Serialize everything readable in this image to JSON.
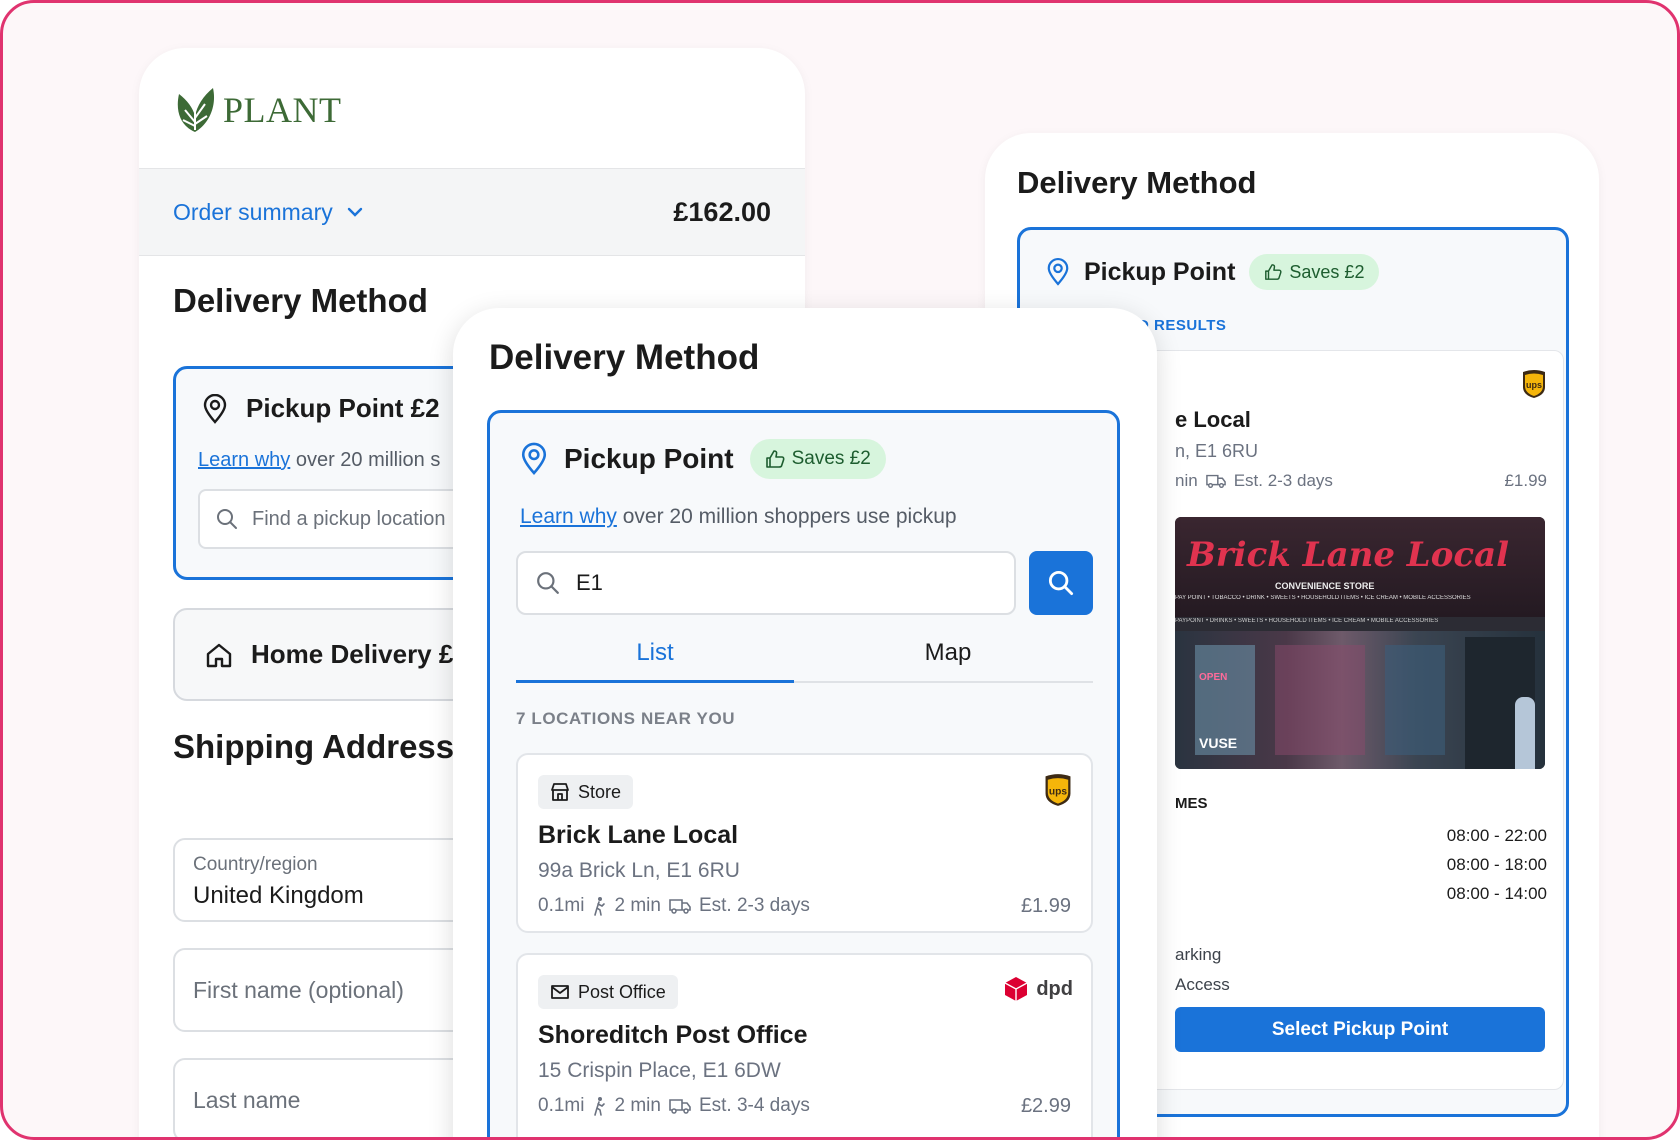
{
  "brand": {
    "name": "PLANT",
    "color": "#3d6a36"
  },
  "colors": {
    "accent": "#1a73d9",
    "frame": "#e0336f",
    "save_badge_bg": "#d7f5dd",
    "save_badge_text": "#1d5d2f"
  },
  "left_panel": {
    "order_summary_label": "Order summary",
    "order_total": "£162.00",
    "delivery_title": "Delivery Method",
    "pickup_label": "Pickup Point £2",
    "learn_link": "Learn why",
    "learn_rest": "over 20 million s",
    "search_placeholder": "Find a pickup location",
    "home_label": "Home Delivery £",
    "shipping_title": "Shipping Address",
    "country_label": "Country/region",
    "country_value": "United Kingdom",
    "first_name_placeholder": "First name (optional)",
    "last_name_placeholder": "Last name"
  },
  "center_panel": {
    "title": "Delivery Method",
    "pickup_label": "Pickup Point",
    "saves_badge": "Saves £2",
    "learn_link": "Learn why",
    "learn_rest": "over 20 million shoppers use pickup",
    "search_value": "E1",
    "tabs": [
      {
        "label": "List",
        "active": true
      },
      {
        "label": "Map",
        "active": false
      }
    ],
    "count_label": "7 LOCATIONS NEAR YOU",
    "locations": [
      {
        "type": "Store",
        "type_icon": "store-icon",
        "carrier": "ups",
        "name": "Brick Lane Local",
        "address": "99a Brick Ln, E1 6RU",
        "distance": "0.1mi",
        "walk": "2 min",
        "est": "Est. 2-3 days",
        "price": "£1.99"
      },
      {
        "type": "Post Office",
        "type_icon": "envelope-icon",
        "carrier": "dpd",
        "name": "Shoreditch Post Office",
        "address": "15 Crispin Place, E1 6DW",
        "distance": "0.1mi",
        "walk": "2 min",
        "est": "Est. 3-4 days",
        "price": "£2.99"
      }
    ]
  },
  "right_panel": {
    "title": "Delivery Method",
    "pickup_label": "Pickup Point",
    "saves_badge": "Saves £2",
    "results_partial": "D RESULTS",
    "carrier": "ups",
    "name_partial": "e Local",
    "address_partial": "n, E1 6RU",
    "walk_partial": "nin",
    "est": "Est. 2-3 days",
    "price": "£1.99",
    "sign_text": "Brick Lane Local",
    "sign_sub": "CONVENIENCE STORE",
    "sign_ticker_1": "PAY POINT • TOBACCO • DRINK • SWEETS • HOUSEHOLD ITEMS • ICE CREAM • MOBILE ACCESSORIES",
    "sign_ticker_2": "PAYPOINT • DRINKS • SWEETS • HOUSEHOLD ITEMS • ICE CREAM • MOBILE ACCESSORIES",
    "sign_open": "OPEN",
    "sign_vuse": "VUSE",
    "times_header_partial": "MES",
    "times": [
      "08:00 - 22:00",
      "08:00 - 18:00",
      "08:00 - 14:00"
    ],
    "feature_1_partial": "arking",
    "feature_2_partial": "Access",
    "select_button": "Select Pickup Point"
  }
}
